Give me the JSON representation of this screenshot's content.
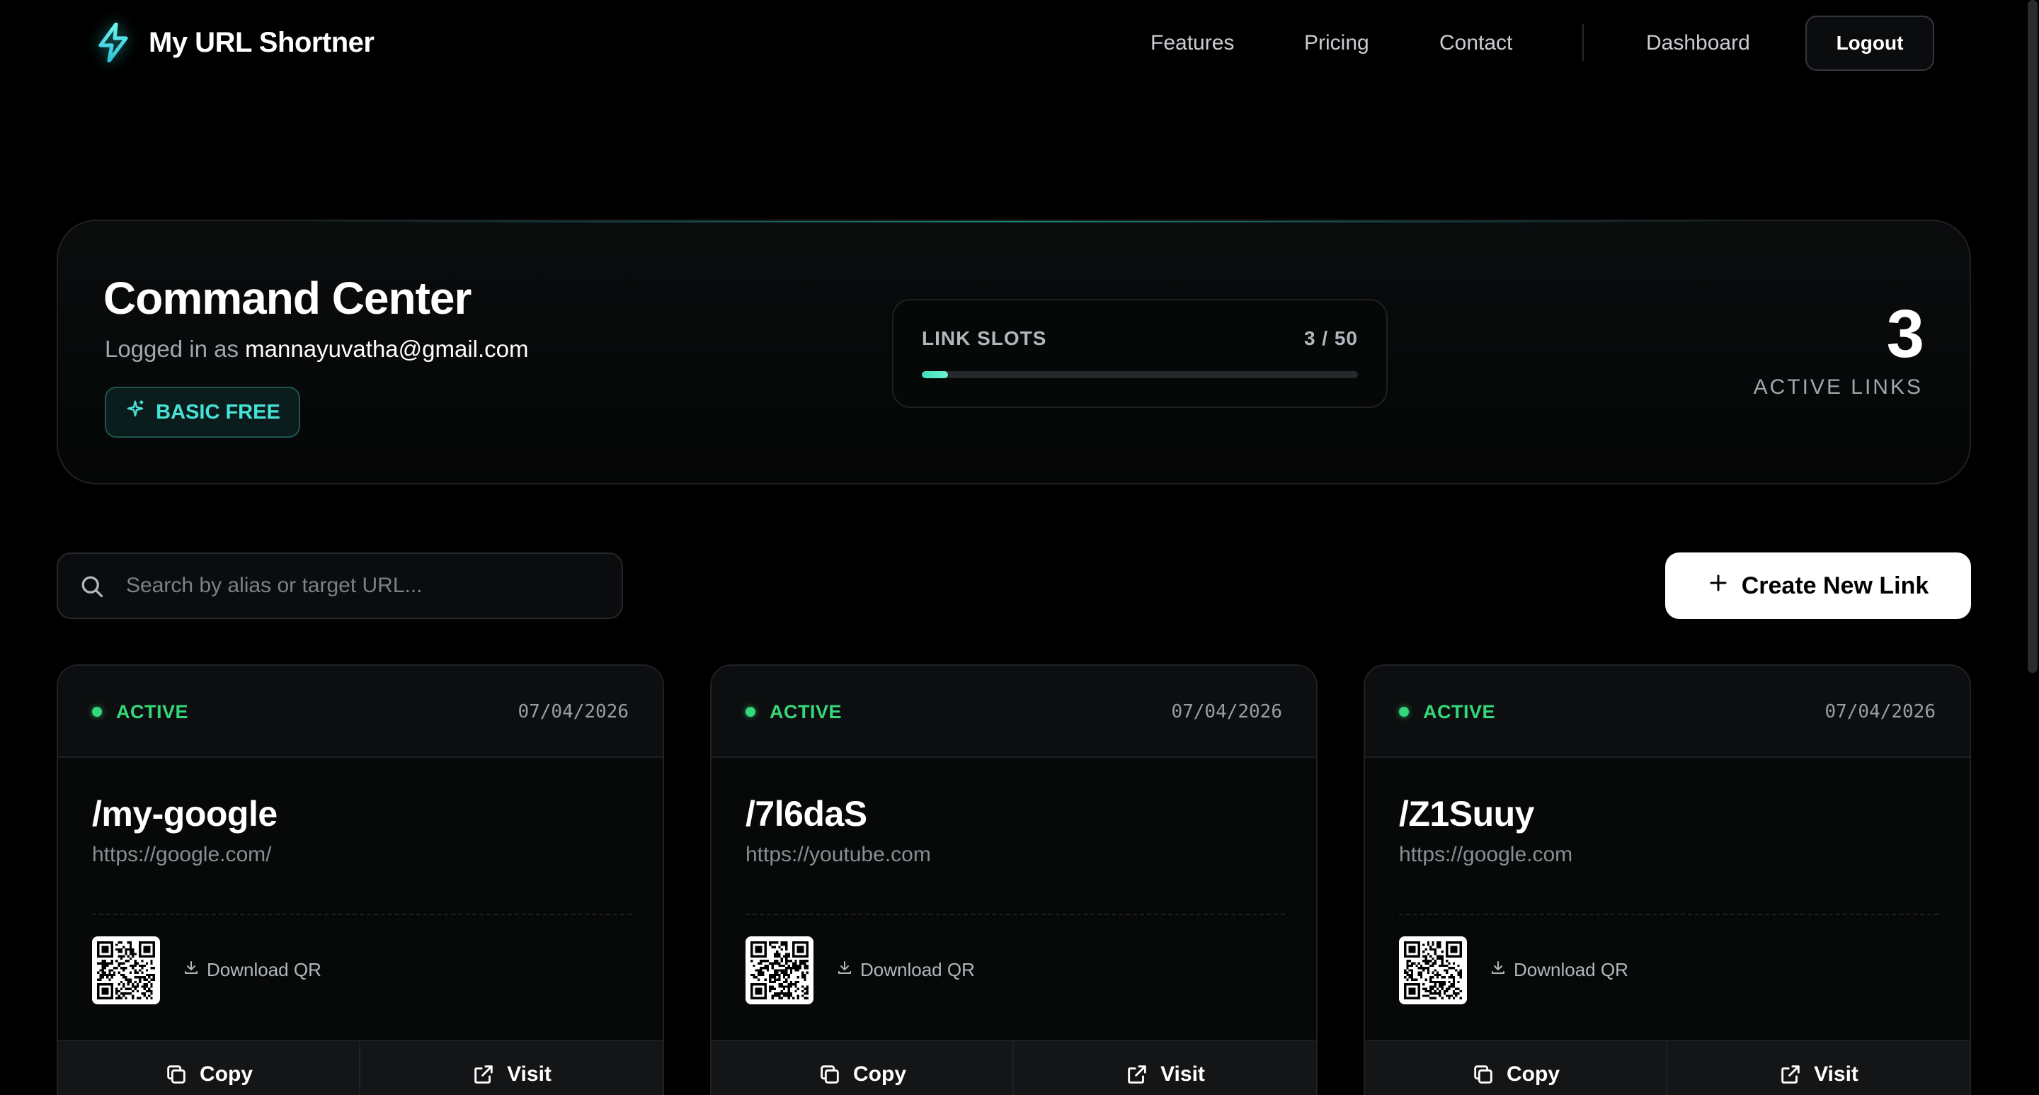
{
  "header": {
    "brand": "My URL Shortner",
    "nav": [
      "Features",
      "Pricing",
      "Contact"
    ],
    "dashboard": "Dashboard",
    "logout": "Logout"
  },
  "summary": {
    "title": "Command Center",
    "logged_in_prefix": "Logged in as",
    "email": "mannayuvatha@gmail.com",
    "plan": "BASIC FREE",
    "slots_label": "LINK SLOTS",
    "slots_count": "3 / 50",
    "slots_used_fraction": 0.06,
    "active_count": "3",
    "active_label": "ACTIVE LINKS"
  },
  "toolbar": {
    "search_placeholder": "Search by alias or target URL...",
    "create_label": "Create New Link"
  },
  "links": [
    {
      "status": "ACTIVE",
      "date": "07/04/2026",
      "alias": "/my-google",
      "target": "https://google.com/",
      "download": "Download QR",
      "copy": "Copy",
      "visit": "Visit"
    },
    {
      "status": "ACTIVE",
      "date": "07/04/2026",
      "alias": "/7l6daS",
      "target": "https://youtube.com",
      "download": "Download QR",
      "copy": "Copy",
      "visit": "Visit"
    },
    {
      "status": "ACTIVE",
      "date": "07/04/2026",
      "alias": "/Z1Suuy",
      "target": "https://google.com",
      "download": "Download QR",
      "copy": "Copy",
      "visit": "Visit"
    }
  ],
  "colors": {
    "accent": "#46e3d8",
    "active": "#34d87a",
    "background": "#000000"
  }
}
